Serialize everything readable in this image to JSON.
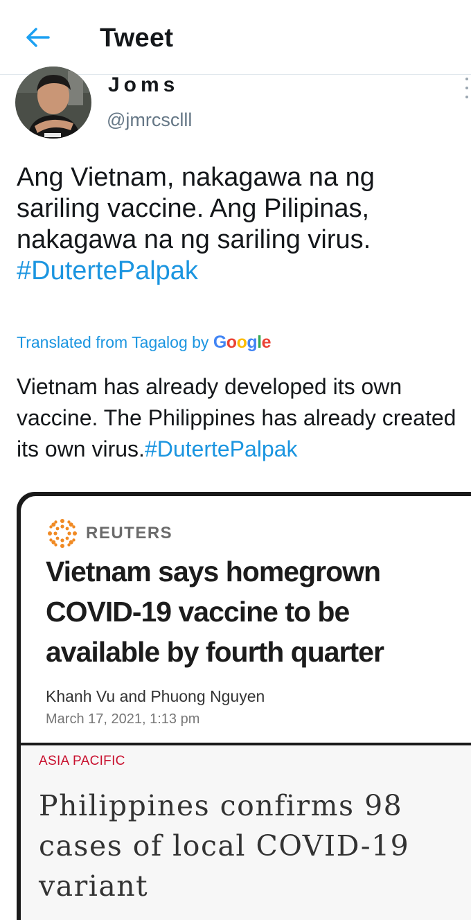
{
  "header": {
    "back_icon": "arrow-left-icon",
    "title": "Tweet"
  },
  "tweet": {
    "author": {
      "display_name": "Joms",
      "handle": "@jmrcsclll"
    },
    "text": "Ang Vietnam, nakagawa na ng sariling vaccine. Ang Pilipinas, nakagawa na ng sariling virus.",
    "hashtag": "#DutertePalpak",
    "translation_label": "Translated from Tagalog by",
    "translation_provider": "Google",
    "translation_text": "Vietnam has already developed its own vaccine. The Philippines has already created its own virus.",
    "translation_hashtag": "#DutertePalpak"
  },
  "media": {
    "reuters": {
      "source": "REUTERS",
      "headline": "Vietnam says homegrown COVID-19 vaccine to be available by fourth quarter",
      "byline": "Khanh Vu and Phuong Nguyen",
      "date": "March 17, 2021, 1:13 pm"
    },
    "asia_card": {
      "section": "ASIA PACIFIC",
      "headline": "Philippines confirms 98 cases of local COVID-19 variant"
    }
  },
  "colors": {
    "link": "#1b95e0",
    "text": "#14171a",
    "secondary": "#657786"
  }
}
